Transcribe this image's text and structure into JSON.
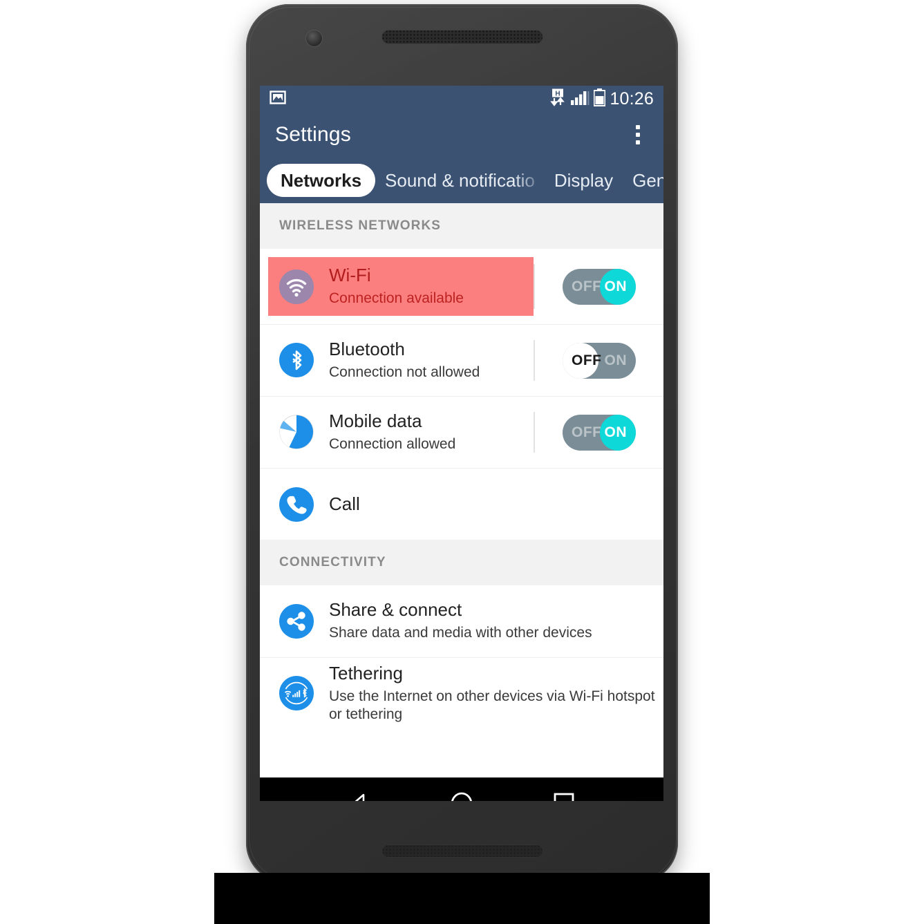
{
  "statusbar": {
    "image_icon": "image-icon",
    "network_icon": "hsdpa-data-icon",
    "signal_icon": "signal-bars-icon",
    "battery_icon": "battery-icon",
    "time": "10:26"
  },
  "appbar": {
    "title": "Settings",
    "overflow_label": "More options"
  },
  "tabs": [
    {
      "label": "Networks",
      "active": true
    },
    {
      "label": "Sound & notificatio",
      "active": false
    },
    {
      "label": "Display",
      "active": false
    },
    {
      "label": "General",
      "active": false
    }
  ],
  "sections": [
    {
      "header": "WIRELESS NETWORKS",
      "rows": [
        {
          "name": "wifi",
          "icon": "wifi-icon",
          "title": "Wi-Fi",
          "subtitle": "Connection available",
          "highlighted": true,
          "toggle": {
            "state": "on",
            "off_label": "OFF",
            "on_label": "ON"
          }
        },
        {
          "name": "bluetooth",
          "icon": "bluetooth-icon",
          "title": "Bluetooth",
          "subtitle": "Connection not allowed",
          "highlighted": false,
          "toggle": {
            "state": "off",
            "off_label": "OFF",
            "on_label": "ON"
          }
        },
        {
          "name": "mobile-data",
          "icon": "pie-chart-icon",
          "title": "Mobile data",
          "subtitle": "Connection allowed",
          "highlighted": false,
          "toggle": {
            "state": "on",
            "off_label": "OFF",
            "on_label": "ON"
          }
        },
        {
          "name": "call",
          "icon": "phone-icon",
          "title": "Call",
          "subtitle": "",
          "highlighted": false,
          "toggle": null
        }
      ]
    },
    {
      "header": "CONNECTIVITY",
      "rows": [
        {
          "name": "share-and-connect",
          "icon": "share-icon",
          "title": "Share & connect",
          "subtitle": "Share data and media with other devices",
          "highlighted": false,
          "toggle": null
        },
        {
          "name": "tethering",
          "icon": "tethering-icon",
          "title": "Tethering",
          "subtitle": "Use the Internet on other devices via Wi-Fi hotspot or tethering",
          "highlighted": false,
          "toggle": null
        }
      ]
    }
  ],
  "navbar": {
    "back": "back-button",
    "home": "home-button",
    "recents": "recents-button"
  },
  "colors": {
    "appbar": "#3b5272",
    "accent_blue": "#1d8fe8",
    "toggle_on": "#0fd8d8",
    "toggle_track": "#7b8d96",
    "highlight": "#fc7f7f",
    "highlight_text": "#b11c1c",
    "section_bg": "#f2f2f2"
  }
}
